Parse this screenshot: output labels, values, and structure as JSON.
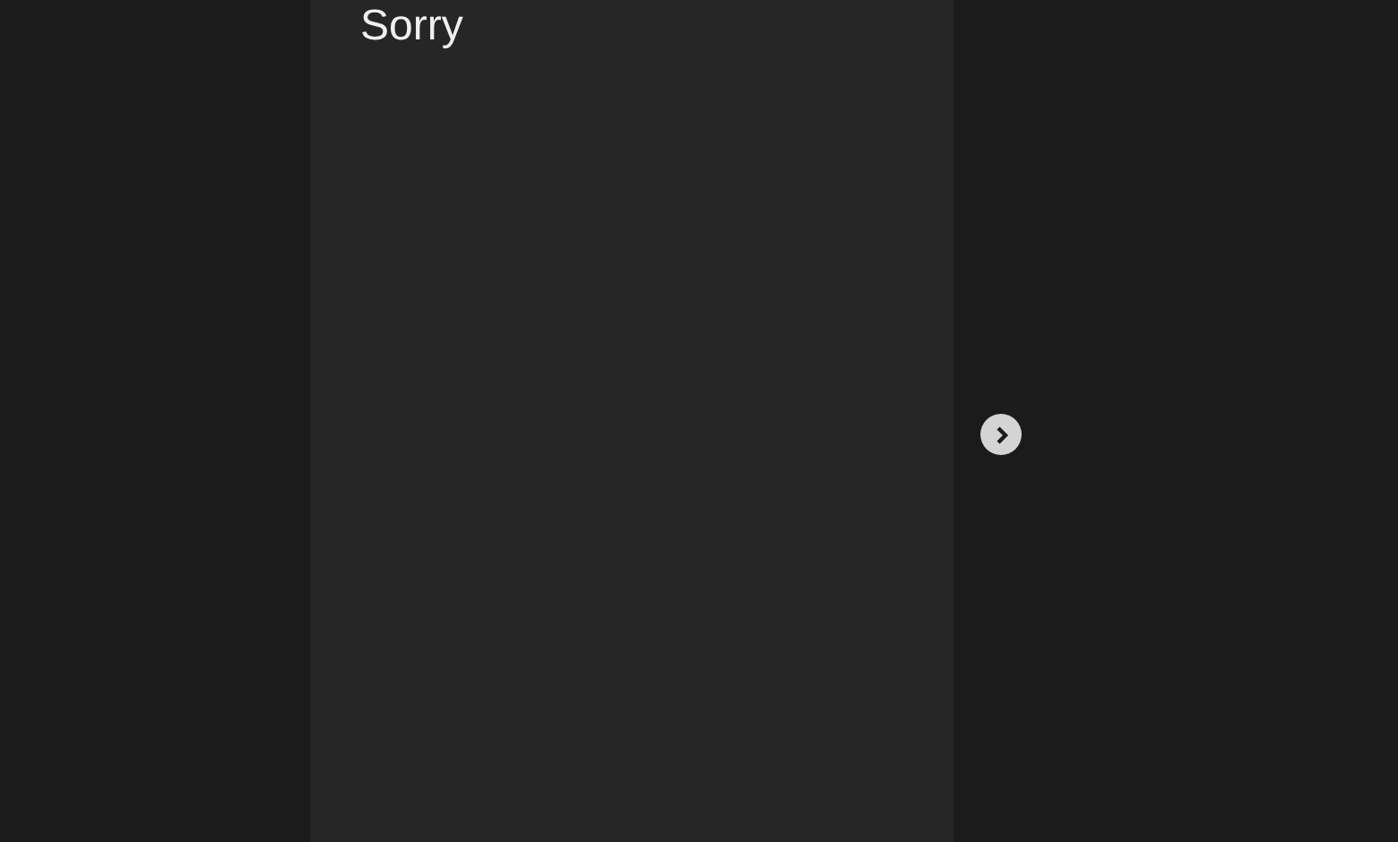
{
  "card": {
    "title": "Sorry"
  },
  "next_button": {
    "kind": "next"
  }
}
